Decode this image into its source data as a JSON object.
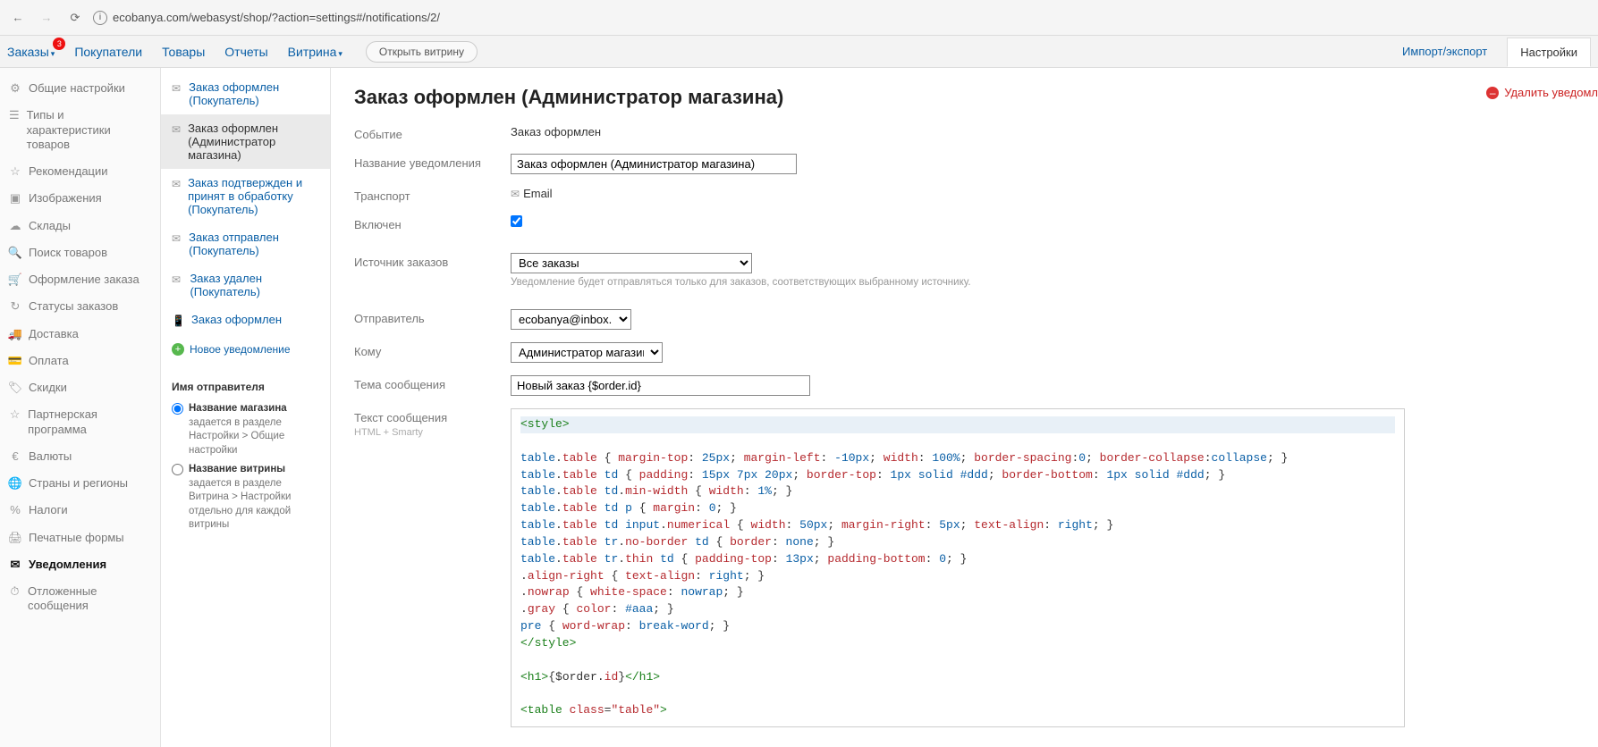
{
  "chrome": {
    "url": "ecobanya.com/webasyst/shop/?action=settings#/notifications/2/"
  },
  "topnav": {
    "items": [
      "Заказы",
      "Покупатели",
      "Товары",
      "Отчеты",
      "Витрина"
    ],
    "orders_badge": "3",
    "open_store": "Открыть витрину",
    "right_link": "Импорт/экспорт",
    "right_tab": "Настройки"
  },
  "sidebar1": [
    {
      "label": "Общие настройки"
    },
    {
      "label": "Типы и характеристики товаров"
    },
    {
      "label": "Рекомендации"
    },
    {
      "label": "Изображения"
    },
    {
      "label": "Склады"
    },
    {
      "label": "Поиск товаров"
    },
    {
      "label": "Оформление заказа"
    },
    {
      "label": "Статусы заказов"
    },
    {
      "label": "Доставка"
    },
    {
      "label": "Оплата"
    },
    {
      "label": "Скидки"
    },
    {
      "label": "Партнерская программа"
    },
    {
      "label": "Валюты"
    },
    {
      "label": "Страны и регионы"
    },
    {
      "label": "Налоги"
    },
    {
      "label": "Печатные формы"
    },
    {
      "label": "Уведомления",
      "active": true
    },
    {
      "label": "Отложенные сообщения"
    }
  ],
  "sidebar2": {
    "items": [
      {
        "label": "Заказ оформлен (Покупатель)"
      },
      {
        "label": "Заказ оформлен (Администратор магазина)",
        "active": true
      },
      {
        "label": "Заказ подтвержден и принят в обработку (Покупатель)"
      },
      {
        "label": "Заказ отправлен (Покупатель)"
      },
      {
        "label": "Заказ удален (Покупатель)"
      },
      {
        "label": "Заказ оформлен",
        "icon": "phone"
      }
    ],
    "new": "Новое уведомление",
    "sender_title": "Имя отправителя",
    "opt1_b": "Название магазина",
    "opt1_t": " задается в разделе Настройки > Общие настройки",
    "opt2_b": "Название витрины",
    "opt2_t": " задается в разделе Витрина > Настройки отдельно для каждой витрины"
  },
  "page": {
    "title": "Заказ оформлен (Администратор магазина)",
    "delete": "Удалить уведомл",
    "labels": {
      "event": "Событие",
      "name": "Название уведомления",
      "transport": "Транспорт",
      "enabled": "Включен",
      "source": "Источник заказов",
      "sender": "Отправитель",
      "to": "Кому",
      "subject": "Тема сообщения",
      "body": "Текст сообщения",
      "body_sub": "HTML + Smarty"
    },
    "values": {
      "event": "Заказ оформлен",
      "name": "Заказ оформлен (Администратор магазина)",
      "transport": "Email",
      "source": "Все заказы",
      "source_hint": "Уведомление будет отправляться только для заказов, соответствующих выбранному источнику.",
      "sender": "ecobanya@inbox.ru",
      "to": "Администратор магазина",
      "subject": "Новый заказ {$order.id}"
    },
    "code": [
      {
        "type": "hl",
        "tokens": [
          [
            "tag",
            "<style>"
          ]
        ]
      },
      {
        "tokens": [
          [
            "sel",
            "table"
          ],
          [
            "plain",
            "."
          ],
          [
            "cls",
            "table"
          ],
          [
            "plain",
            " { "
          ],
          [
            "prop",
            "margin-top"
          ],
          [
            "plain",
            ": "
          ],
          [
            "num",
            "25px"
          ],
          [
            "plain",
            "; "
          ],
          [
            "prop",
            "margin-left"
          ],
          [
            "plain",
            ": "
          ],
          [
            "num",
            "-10px"
          ],
          [
            "plain",
            "; "
          ],
          [
            "prop",
            "width"
          ],
          [
            "plain",
            ": "
          ],
          [
            "num",
            "100%"
          ],
          [
            "plain",
            "; "
          ],
          [
            "prop",
            "border-spacing"
          ],
          [
            "plain",
            ":"
          ],
          [
            "num",
            "0"
          ],
          [
            "plain",
            "; "
          ],
          [
            "prop",
            "border-collapse"
          ],
          [
            "plain",
            ":"
          ],
          [
            "val",
            "collapse"
          ],
          [
            "plain",
            "; }"
          ]
        ]
      },
      {
        "tokens": [
          [
            "sel",
            "table"
          ],
          [
            "plain",
            "."
          ],
          [
            "cls",
            "table"
          ],
          [
            "plain",
            " "
          ],
          [
            "sel",
            "td"
          ],
          [
            "plain",
            " { "
          ],
          [
            "prop",
            "padding"
          ],
          [
            "plain",
            ": "
          ],
          [
            "num",
            "15px 7px 20px"
          ],
          [
            "plain",
            "; "
          ],
          [
            "prop",
            "border-top"
          ],
          [
            "plain",
            ": "
          ],
          [
            "num",
            "1px"
          ],
          [
            "plain",
            " "
          ],
          [
            "val",
            "solid"
          ],
          [
            "plain",
            " "
          ],
          [
            "val",
            "#ddd"
          ],
          [
            "plain",
            "; "
          ],
          [
            "prop",
            "border-bottom"
          ],
          [
            "plain",
            ": "
          ],
          [
            "num",
            "1px"
          ],
          [
            "plain",
            " "
          ],
          [
            "val",
            "solid"
          ],
          [
            "plain",
            " "
          ],
          [
            "val",
            "#ddd"
          ],
          [
            "plain",
            "; }"
          ]
        ]
      },
      {
        "tokens": [
          [
            "sel",
            "table"
          ],
          [
            "plain",
            "."
          ],
          [
            "cls",
            "table"
          ],
          [
            "plain",
            " "
          ],
          [
            "sel",
            "td"
          ],
          [
            "plain",
            "."
          ],
          [
            "cls",
            "min-width"
          ],
          [
            "plain",
            " { "
          ],
          [
            "prop",
            "width"
          ],
          [
            "plain",
            ": "
          ],
          [
            "num",
            "1%"
          ],
          [
            "plain",
            "; }"
          ]
        ]
      },
      {
        "tokens": [
          [
            "sel",
            "table"
          ],
          [
            "plain",
            "."
          ],
          [
            "cls",
            "table"
          ],
          [
            "plain",
            " "
          ],
          [
            "sel",
            "td"
          ],
          [
            "plain",
            " "
          ],
          [
            "sel",
            "p"
          ],
          [
            "plain",
            " { "
          ],
          [
            "prop",
            "margin"
          ],
          [
            "plain",
            ": "
          ],
          [
            "num",
            "0"
          ],
          [
            "plain",
            "; }"
          ]
        ]
      },
      {
        "tokens": [
          [
            "sel",
            "table"
          ],
          [
            "plain",
            "."
          ],
          [
            "cls",
            "table"
          ],
          [
            "plain",
            " "
          ],
          [
            "sel",
            "td"
          ],
          [
            "plain",
            " "
          ],
          [
            "sel",
            "input"
          ],
          [
            "plain",
            "."
          ],
          [
            "cls",
            "numerical"
          ],
          [
            "plain",
            " { "
          ],
          [
            "prop",
            "width"
          ],
          [
            "plain",
            ": "
          ],
          [
            "num",
            "50px"
          ],
          [
            "plain",
            "; "
          ],
          [
            "prop",
            "margin-right"
          ],
          [
            "plain",
            ": "
          ],
          [
            "num",
            "5px"
          ],
          [
            "plain",
            "; "
          ],
          [
            "prop",
            "text-align"
          ],
          [
            "plain",
            ": "
          ],
          [
            "val",
            "right"
          ],
          [
            "plain",
            "; }"
          ]
        ]
      },
      {
        "tokens": [
          [
            "sel",
            "table"
          ],
          [
            "plain",
            "."
          ],
          [
            "cls",
            "table"
          ],
          [
            "plain",
            " "
          ],
          [
            "sel",
            "tr"
          ],
          [
            "plain",
            "."
          ],
          [
            "cls",
            "no-border"
          ],
          [
            "plain",
            " "
          ],
          [
            "sel",
            "td"
          ],
          [
            "plain",
            " { "
          ],
          [
            "prop",
            "border"
          ],
          [
            "plain",
            ": "
          ],
          [
            "val",
            "none"
          ],
          [
            "plain",
            "; }"
          ]
        ]
      },
      {
        "tokens": [
          [
            "sel",
            "table"
          ],
          [
            "plain",
            "."
          ],
          [
            "cls",
            "table"
          ],
          [
            "plain",
            " "
          ],
          [
            "sel",
            "tr"
          ],
          [
            "plain",
            "."
          ],
          [
            "cls",
            "thin"
          ],
          [
            "plain",
            " "
          ],
          [
            "sel",
            "td"
          ],
          [
            "plain",
            " { "
          ],
          [
            "prop",
            "padding-top"
          ],
          [
            "plain",
            ": "
          ],
          [
            "num",
            "13px"
          ],
          [
            "plain",
            "; "
          ],
          [
            "prop",
            "padding-bottom"
          ],
          [
            "plain",
            ": "
          ],
          [
            "num",
            "0"
          ],
          [
            "plain",
            "; }"
          ]
        ]
      },
      {
        "tokens": [
          [
            "plain",
            "."
          ],
          [
            "cls",
            "align-right"
          ],
          [
            "plain",
            " { "
          ],
          [
            "prop",
            "text-align"
          ],
          [
            "plain",
            ": "
          ],
          [
            "val",
            "right"
          ],
          [
            "plain",
            "; }"
          ]
        ]
      },
      {
        "tokens": [
          [
            "plain",
            "."
          ],
          [
            "cls",
            "nowrap"
          ],
          [
            "plain",
            " { "
          ],
          [
            "prop",
            "white-space"
          ],
          [
            "plain",
            ": "
          ],
          [
            "val",
            "nowrap"
          ],
          [
            "plain",
            "; }"
          ]
        ]
      },
      {
        "tokens": [
          [
            "plain",
            "."
          ],
          [
            "cls",
            "gray"
          ],
          [
            "plain",
            " { "
          ],
          [
            "prop",
            "color"
          ],
          [
            "plain",
            ": "
          ],
          [
            "val",
            "#aaa"
          ],
          [
            "plain",
            "; }"
          ]
        ]
      },
      {
        "tokens": [
          [
            "sel",
            "pre"
          ],
          [
            "plain",
            " { "
          ],
          [
            "prop",
            "word-wrap"
          ],
          [
            "plain",
            ": "
          ],
          [
            "val",
            "break-word"
          ],
          [
            "plain",
            "; }"
          ]
        ]
      },
      {
        "tokens": [
          [
            "tag",
            "</style>"
          ]
        ]
      },
      {
        "tokens": [
          [
            "plain",
            ""
          ]
        ]
      },
      {
        "tokens": [
          [
            "tag",
            "<h1>"
          ],
          [
            "plain",
            "{$order."
          ],
          [
            "kw",
            "id"
          ],
          [
            "plain",
            "}"
          ],
          [
            "tag",
            "</h1>"
          ]
        ]
      },
      {
        "tokens": [
          [
            "plain",
            ""
          ]
        ]
      },
      {
        "tokens": [
          [
            "tag",
            "<table "
          ],
          [
            "kw",
            "class"
          ],
          [
            "plain",
            "="
          ],
          [
            "str",
            "\"table\""
          ],
          [
            "tag",
            ">"
          ]
        ]
      }
    ]
  }
}
